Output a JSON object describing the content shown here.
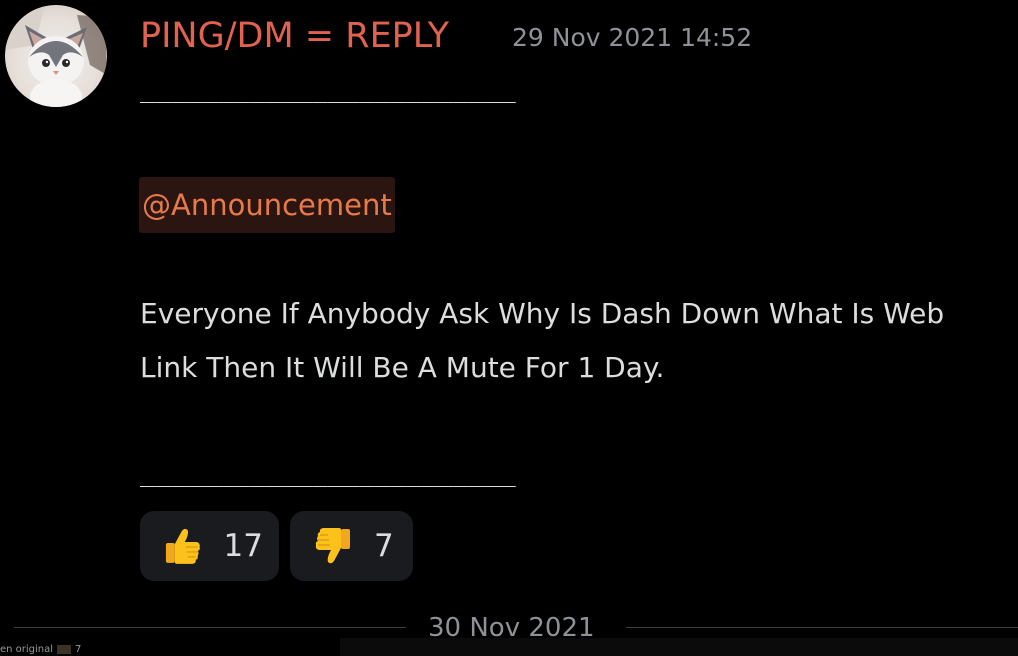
{
  "message": {
    "author": "PING/DM = REPLY",
    "timestamp": "29 Nov 2021 14:52",
    "rule_top": "________________________",
    "mention": "@Announcement",
    "body": "Everyone If Anybody Ask Why Is Dash Down What Is Web Link Then It Will Be A Mute For 1 Day.",
    "rule_bottom": "________________________",
    "avatar": {
      "icon": "cat-icon"
    }
  },
  "reactions": [
    {
      "emoji": "thumbs-up-icon",
      "count": "17"
    },
    {
      "emoji": "thumbs-down-icon",
      "count": "7"
    }
  ],
  "date_divider": "30 Nov 2021",
  "corner_overlay": {
    "label": "en original",
    "count": "7"
  },
  "colors": {
    "background": "#000000",
    "username": "#e0624f",
    "mention_text": "#e87a4a",
    "mention_bg": "#2a1510",
    "reaction_bg": "#1a1b1e",
    "muted": "#8e9297"
  }
}
